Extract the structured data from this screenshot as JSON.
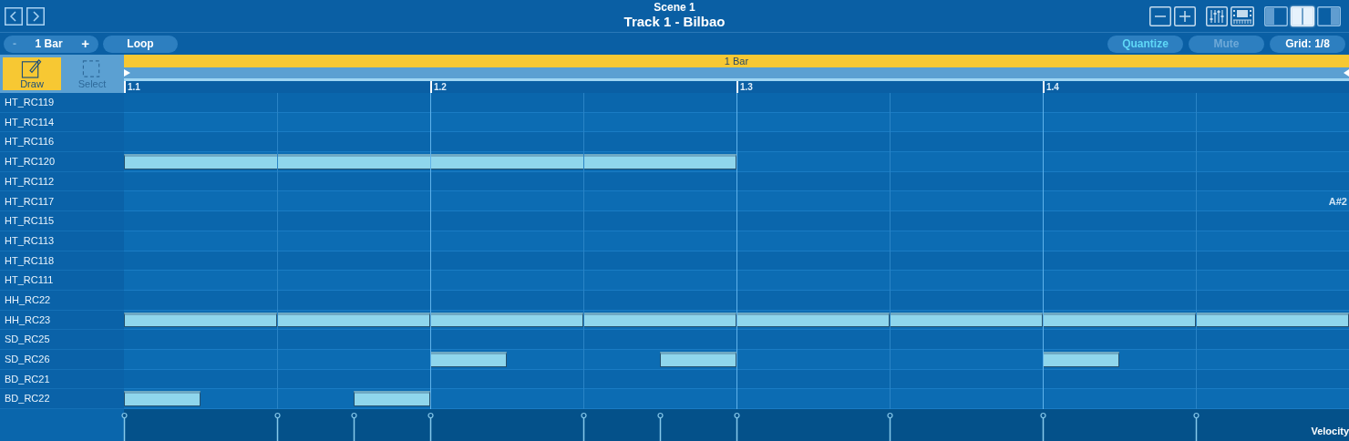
{
  "header": {
    "subtitle": "Scene 1",
    "title": "Track 1 - Bilbao"
  },
  "nav_buttons": [
    {
      "kind": "back"
    },
    {
      "kind": "forward"
    }
  ],
  "tool_icons": [
    {
      "kind": "zoom-out",
      "selected": false
    },
    {
      "kind": "zoom-in",
      "selected": false
    },
    {
      "kind": "mixer",
      "selected": false
    },
    {
      "kind": "keyboard",
      "selected": false
    },
    {
      "kind": "left-panel",
      "selected": false
    },
    {
      "kind": "split",
      "selected": true
    },
    {
      "kind": "right-panel",
      "selected": false
    }
  ],
  "length_control": {
    "minus": "-",
    "value": "1 Bar",
    "plus": "+"
  },
  "loop_button": "Loop",
  "right_buttons": [
    {
      "label": "Quantize",
      "active": true,
      "disabled": false
    },
    {
      "label": "Mute",
      "active": false,
      "disabled": true
    },
    {
      "label": "Grid: 1/8",
      "active": false,
      "disabled": false
    }
  ],
  "tools": [
    {
      "label": "Draw",
      "kind": "draw",
      "selected": true
    },
    {
      "label": "Select",
      "kind": "select",
      "selected": false
    }
  ],
  "loop_region": "1 Bar",
  "ruler": [
    "1.1",
    "1.2",
    "1.3",
    "1.4"
  ],
  "rows": [
    {
      "name": "HT_RC119"
    },
    {
      "name": "HT_RC114"
    },
    {
      "name": "HT_RC116"
    },
    {
      "name": "HT_RC120"
    },
    {
      "name": "HT_RC112"
    },
    {
      "name": "HT_RC117",
      "pitch": "A#2"
    },
    {
      "name": "HT_RC115"
    },
    {
      "name": "HT_RC113"
    },
    {
      "name": "HT_RC118"
    },
    {
      "name": "HT_RC111"
    },
    {
      "name": "HH_RC22"
    },
    {
      "name": "HH_RC23"
    },
    {
      "name": "SD_RC25"
    },
    {
      "name": "SD_RC26"
    },
    {
      "name": "BD_RC21"
    },
    {
      "name": "BD_RC22"
    }
  ],
  "velocity_label": "Velocity"
}
